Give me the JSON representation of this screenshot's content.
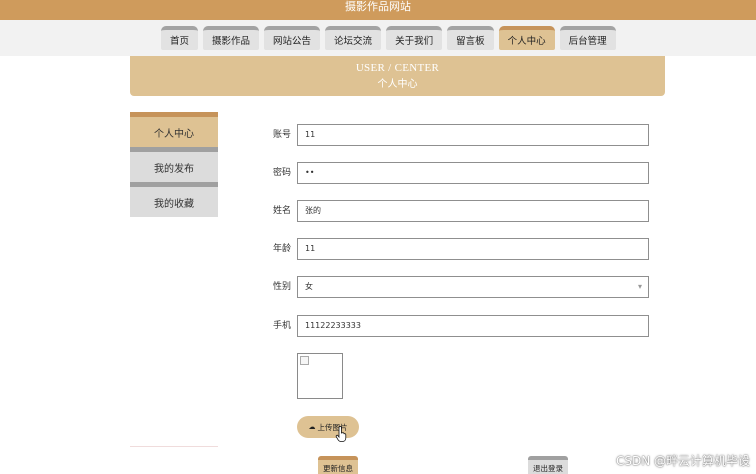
{
  "site": {
    "title": "摄影作品网站"
  },
  "nav": {
    "items": [
      {
        "label": "首页",
        "active": false
      },
      {
        "label": "摄影作品",
        "active": false
      },
      {
        "label": "网站公告",
        "active": false
      },
      {
        "label": "论坛交流",
        "active": false
      },
      {
        "label": "关于我们",
        "active": false
      },
      {
        "label": "留言板",
        "active": false
      },
      {
        "label": "个人中心",
        "active": true
      },
      {
        "label": "后台管理",
        "active": false
      }
    ]
  },
  "banner": {
    "en": "USER / CENTER",
    "zh": "个人中心"
  },
  "sidebar": {
    "items": [
      {
        "label": "个人中心",
        "active": true
      },
      {
        "label": "我的发布",
        "active": false
      },
      {
        "label": "我的收藏",
        "active": false
      }
    ]
  },
  "form": {
    "account": {
      "label": "账号",
      "value": "11"
    },
    "password": {
      "label": "密码",
      "value": "••"
    },
    "name": {
      "label": "姓名",
      "value": "张的"
    },
    "age": {
      "label": "年龄",
      "value": "11"
    },
    "gender": {
      "label": "性别",
      "value": "女"
    },
    "phone": {
      "label": "手机",
      "value": "11122233333"
    }
  },
  "upload": {
    "label": "上传图片"
  },
  "buttons": {
    "update": "更新信息",
    "logout": "退出登录"
  },
  "watermark": "CSDN @畔云计算机毕设",
  "colors": {
    "accent": "#cf9b5c",
    "tab_active": "#dec293",
    "tab_idle": "#e2e2e2"
  }
}
